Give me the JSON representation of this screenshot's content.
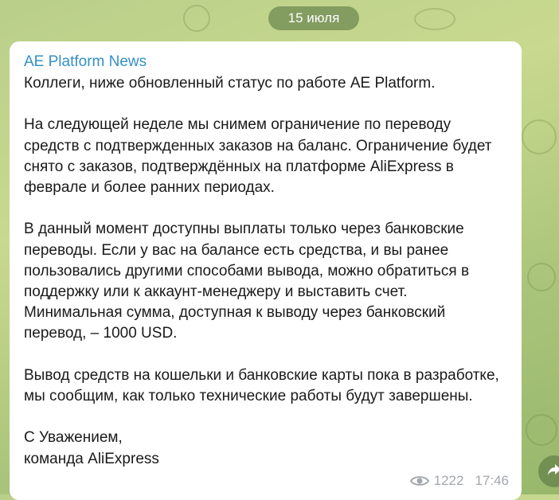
{
  "date_separator": "15 июля",
  "message": {
    "channel_name": "AE Platform News",
    "paragraphs": [
      "Коллеги, ниже обновленный статус по работе AE Platform.",
      "На следующей неделе мы снимем ограничение по переводу средств с подтвержденных заказов на баланс. Ограничение будет снято с заказов, подтверждённых на платформе AliExpress в феврале и более ранних периодах.",
      "В данный момент доступны выплаты только через банковские переводы. Если у вас на балансе есть средства, и вы ранее пользовались другими способами вывода, можно обратиться в поддержку или к аккаунт-менеджеру и выставить счет. Минимальная сумма, доступная к выводу через банковский перевод, – 1000 USD.",
      "Вывод средств на кошельки и банковские карты пока в разработке, мы сообщим, как только технические работы будут завершены.",
      "С Уважением,\nкоманда AliExpress"
    ],
    "views": "1222",
    "time": "17:46"
  },
  "icons": {
    "views": "eye-icon",
    "share": "share-arrow-icon"
  },
  "colors": {
    "channel_name": "#3390c7",
    "meta_text": "#a3a7ab",
    "bubble_background": "#ffffff",
    "chip_background": "#6e8a4e"
  }
}
